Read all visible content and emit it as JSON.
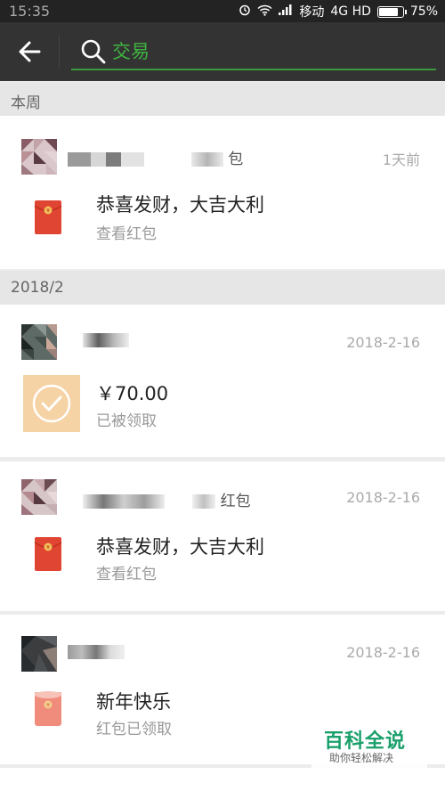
{
  "status_bar": {
    "time": "15:35",
    "carrier": "移动",
    "network": "4G HD",
    "battery_percent": "75%",
    "battery_level": 0.75
  },
  "toolbar": {
    "back_icon": "arrow-left-icon",
    "search_icon": "search-icon",
    "search_value": "交易"
  },
  "sections": [
    {
      "label": "本周"
    },
    {
      "label": "2018/2"
    }
  ],
  "items": [
    {
      "sender_visible": "包",
      "time": "1天前",
      "title": "恭喜发财，大吉大利",
      "subtitle": "查看红包",
      "icon": "red-packet-icon"
    },
    {
      "sender_visible": "",
      "time": "2018-2-16",
      "title": "￥70.00",
      "subtitle": "已被领取",
      "icon": "received-check-icon"
    },
    {
      "sender_visible": "红包",
      "time": "2018-2-16",
      "title": "恭喜发财，大吉大利",
      "subtitle": "查看红包",
      "icon": "red-packet-icon"
    },
    {
      "sender_visible": "",
      "time": "2018-2-16",
      "title": "新年快乐",
      "subtitle": "红包已领取",
      "icon": "opened-red-packet-icon"
    }
  ],
  "watermark": {
    "main": "百科全说",
    "sub": "助你轻松解决"
  },
  "colors": {
    "toolbar": "#333333",
    "accent_green": "#3fb441",
    "red_packet": "#e04432"
  }
}
